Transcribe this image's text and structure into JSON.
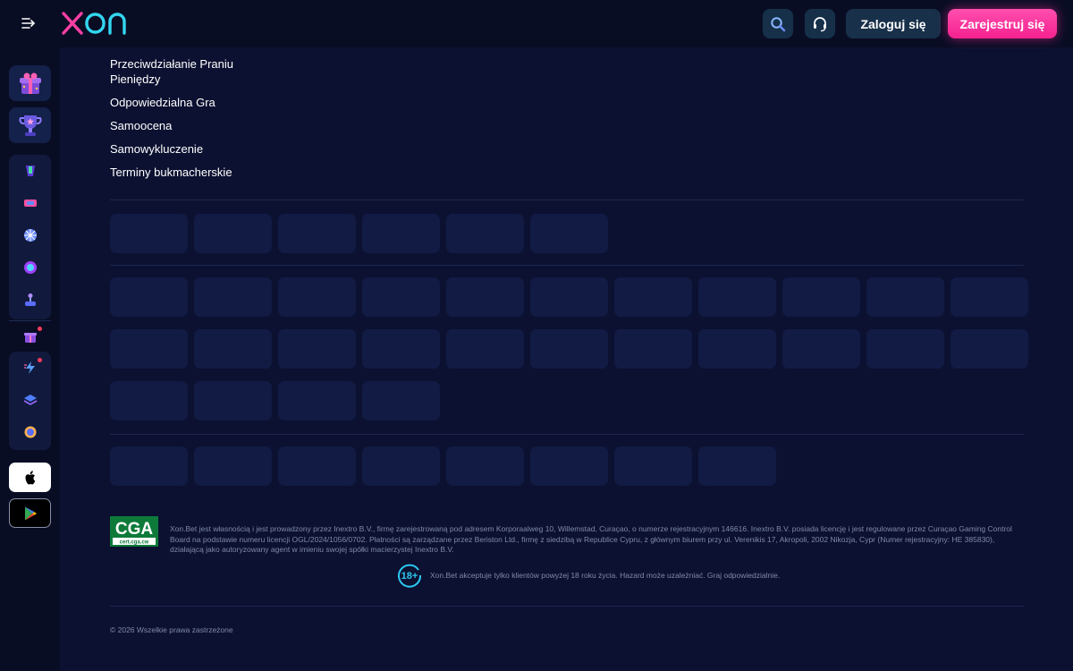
{
  "header": {
    "logo_text": "XON",
    "login_label": "Zaloguj się",
    "register_label": "Zarejestruj się",
    "icons": [
      "menu-toggle-icon",
      "search-icon",
      "support-headset-icon"
    ]
  },
  "sidebar": {
    "featured_icons": [
      "gift-box-icon",
      "trophy-icon"
    ],
    "menu_icons": [
      "cocktail-icon",
      "ticket-icon",
      "wheel-icon",
      "ball-icon",
      "joystick-icon",
      "gift-icon",
      "lightning-icon",
      "stack-icon",
      "live-icon"
    ],
    "store_icons": [
      "apple-icon",
      "google-play-icon"
    ]
  },
  "main": {
    "links": [
      "Przeciwdziałanie Praniu Pieniędzy",
      "Odpowiedzialna Gra",
      "Samoocena",
      "Samowykluczenie",
      "Terminy bukmacherskie"
    ]
  },
  "footer": {
    "cga_badge_text": "CGA",
    "cga_badge_subtext": "cert.cga.cw",
    "license_text": "Xon.Bet jest własnością i jest prowadzony przez Inextro B.V., firmę zarejestrowaną pod adresem Korporaalweg 10, Willemstad, Curaçao, o numerze rejestracyjnym 146616. Inextro B.V. posiada licencję i jest regulowane przez Curaçao Gaming Control Board na podstawie numeru licencji OGL/2024/1056/0702. Płatności są zarządzane przez Beriston Ltd., firmę z siedzibą w Republice Cypru, z głównym biurem przy ul. Verenikis 17, Akropoli, 2002 Nikozja, Cypr (Numer rejestracyjny: HE 385830), działającą jako autoryzowany agent w imieniu swojej spółki macierzystej Inextro B.V.",
    "age_badge_text": "18+",
    "age_text": "Xon.Bet akceptuje tylko klientów powyżej 18 roku życia. Hazard może uzależniać. Graj odpowiedzialnie.",
    "copyright": "© 2026 Wszelkie prawa zastrzeżone"
  },
  "colors": {
    "background": "#0c1131",
    "header_background": "#090d24",
    "accent_pink": "#ff2d96",
    "logo_pink": "#ff3fa4",
    "logo_cyan": "#33d6f0",
    "muted_text": "#7f88aa"
  }
}
